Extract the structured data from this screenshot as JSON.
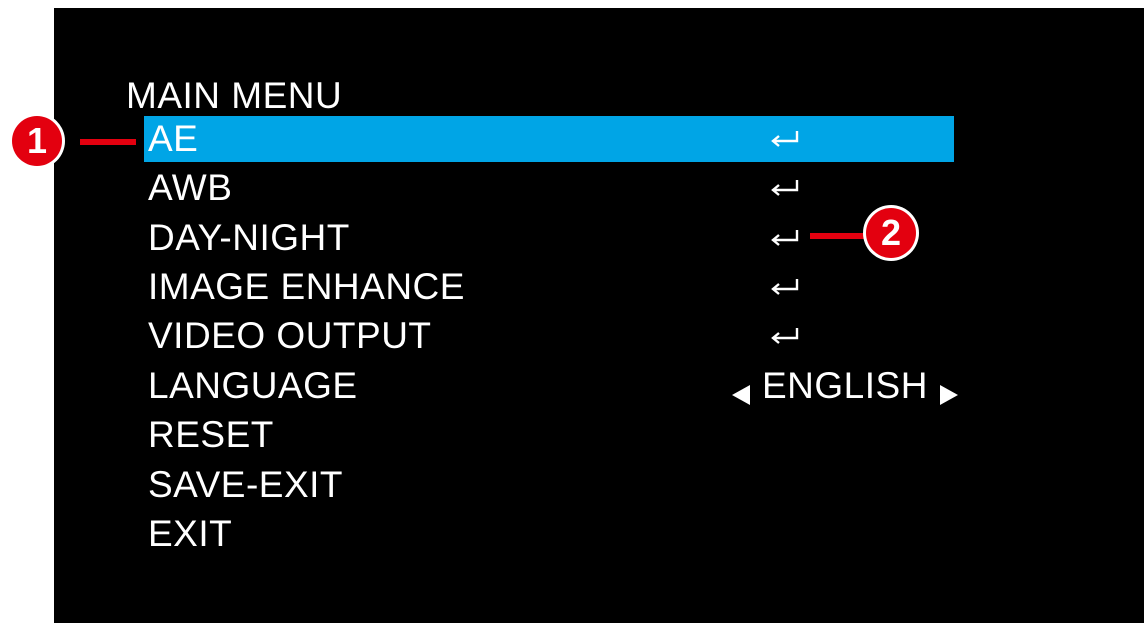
{
  "osd": {
    "title": "MAIN MENU",
    "items": [
      {
        "label": "AE",
        "value_type": "enter",
        "selected": true
      },
      {
        "label": "AWB",
        "value_type": "enter",
        "selected": false
      },
      {
        "label": "DAY-NIGHT",
        "value_type": "enter",
        "selected": false
      },
      {
        "label": "IMAGE ENHANCE",
        "value_type": "enter",
        "selected": false
      },
      {
        "label": "VIDEO OUTPUT",
        "value_type": "enter",
        "selected": false
      },
      {
        "label": "LANGUAGE",
        "value_type": "select",
        "value": "ENGLISH",
        "selected": false
      },
      {
        "label": "RESET",
        "value_type": "none",
        "selected": false
      },
      {
        "label": "SAVE-EXIT",
        "value_type": "none",
        "selected": false
      },
      {
        "label": "EXIT",
        "value_type": "none",
        "selected": false
      }
    ]
  },
  "callouts": [
    {
      "number": "1"
    },
    {
      "number": "2"
    }
  ],
  "colors": {
    "background": "#000000",
    "highlight": "#00a5e6",
    "callout": "#e3000f",
    "text": "#ffffff"
  },
  "icons": {
    "enter": "enter-return-icon",
    "left": "left-triangle-icon",
    "right": "right-triangle-icon"
  }
}
